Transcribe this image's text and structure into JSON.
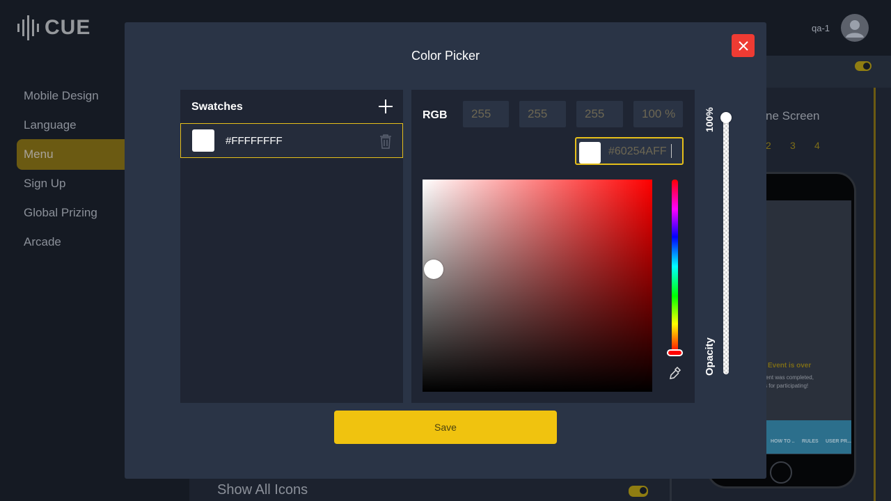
{
  "app": {
    "logo_text": "CUE",
    "user_name": "qa-1"
  },
  "sidebar": {
    "items": [
      {
        "label": "Mobile Design"
      },
      {
        "label": "Language"
      },
      {
        "label": "Menu"
      },
      {
        "label": "Sign Up"
      },
      {
        "label": "Global Prizing"
      },
      {
        "label": "Arcade"
      }
    ],
    "active": "Menu"
  },
  "background": {
    "screen_title": "ne Screen",
    "steps": [
      "2",
      "3",
      "4"
    ],
    "phone": {
      "event_title": "Event is over",
      "event_line1": "ent was completed,",
      "event_line2": "s for participating!",
      "tabs": [
        "HOW TO ..",
        "RULES",
        "USER PR..."
      ]
    },
    "show_all_icons_label": "Show All Icons"
  },
  "modal": {
    "title": "Color Picker",
    "swatches": {
      "heading": "Swatches",
      "items": [
        {
          "hex": "#FFFFFFFF",
          "color": "#FFFFFF"
        }
      ]
    },
    "rgb": {
      "label": "RGB",
      "r": "255",
      "g": "255",
      "b": "255",
      "a": "100 %"
    },
    "hex_value": "#60254AFF",
    "preview_color": "#FFFFFF",
    "hue_color": "#FF0000",
    "opacity": {
      "top_label": "100%",
      "bottom_label": "Opacity",
      "value_percent": 100
    },
    "save_label": "Save"
  },
  "colors": {
    "accent": "#F0C30F",
    "close": "#EE3B33",
    "panel": "#1F2533",
    "modal": "#2A3446"
  },
  "icons": [
    "logo-icon",
    "avatar-icon",
    "close-icon",
    "plus-icon",
    "trash-icon",
    "eyedropper-icon"
  ]
}
